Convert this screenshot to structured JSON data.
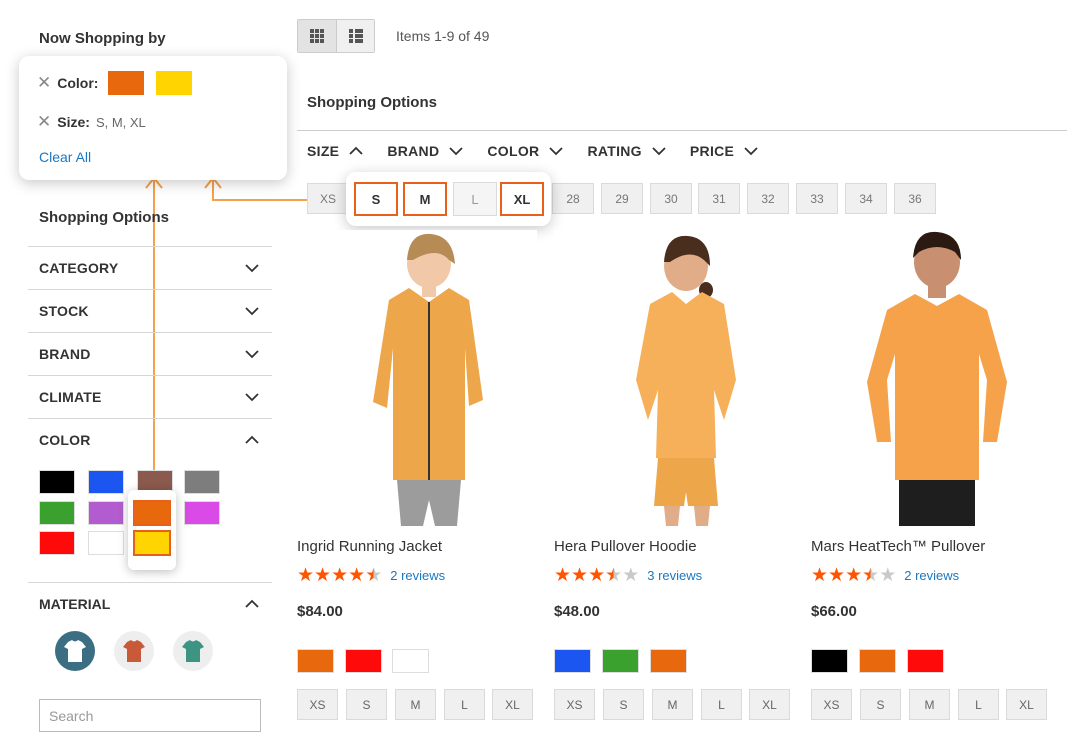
{
  "now_shopping": {
    "title": "Now Shopping by",
    "color_label": "Color:",
    "color_swatches": [
      "#e8690d",
      "#ffd400"
    ],
    "size_label": "Size:",
    "size_values": "S, M, XL",
    "clear_all": "Clear All",
    "remove_icon": "close-icon"
  },
  "sidebar": {
    "title": "Shopping Options",
    "filters": [
      "CATEGORY",
      "STOCK",
      "BRAND",
      "CLIMATE"
    ],
    "color": {
      "label": "COLOR",
      "swatches": [
        "#000000",
        "#1a56ef",
        "#8a5a4e",
        "#7d7d7d",
        "#3aa02e",
        "#b35ccf",
        "#e8690d",
        "#d94ae6",
        "#ff0a0a",
        "#ffffff",
        "#ffd400"
      ]
    },
    "material": {
      "label": "MATERIAL",
      "icons": [
        "t-shirt-icon",
        "t-shirt-icon",
        "t-shirt-icon"
      ],
      "colors": [
        "#3b6e82",
        "#c85a3a",
        "#3e9482"
      ]
    },
    "search_placeholder": "Search"
  },
  "toolbar": {
    "items_count": "Items 1-9 of 49",
    "grid_icon": "grid-view-icon",
    "list_icon": "list-view-icon"
  },
  "main": {
    "title": "Shopping Options",
    "filters": [
      "SIZE",
      "BRAND",
      "COLOR",
      "RATING",
      "PRICE"
    ],
    "size_chips_bg": [
      "XS",
      "28",
      "29",
      "30",
      "31",
      "32",
      "33",
      "34",
      "36"
    ],
    "size_chips_callout": [
      "S",
      "M",
      "L",
      "XL"
    ]
  },
  "products": [
    {
      "name": "Ingrid Running Jacket",
      "rating": 4.5,
      "reviews": "2 reviews",
      "price": "$84.00",
      "swatches": [
        "#e8690d",
        "#ff0a0a",
        "#ffffff"
      ],
      "sizes": [
        "XS",
        "S",
        "M",
        "L",
        "XL"
      ]
    },
    {
      "name": "Hera Pullover Hoodie",
      "rating": 3.5,
      "reviews": "3 reviews",
      "price": "$48.00",
      "swatches": [
        "#1a56ef",
        "#3aa02e",
        "#e8690d"
      ],
      "sizes": [
        "XS",
        "S",
        "M",
        "L",
        "XL"
      ]
    },
    {
      "name": "Mars HeatTech™ Pullover",
      "rating": 3.5,
      "reviews": "2 reviews",
      "price": "$66.00",
      "swatches": [
        "#000000",
        "#e8690d",
        "#ff0a0a"
      ],
      "sizes": [
        "XS",
        "S",
        "M",
        "L",
        "XL"
      ]
    }
  ],
  "colors": {
    "accent": "#e8601a",
    "link": "#1979c3",
    "connector": "#f5a04a"
  }
}
